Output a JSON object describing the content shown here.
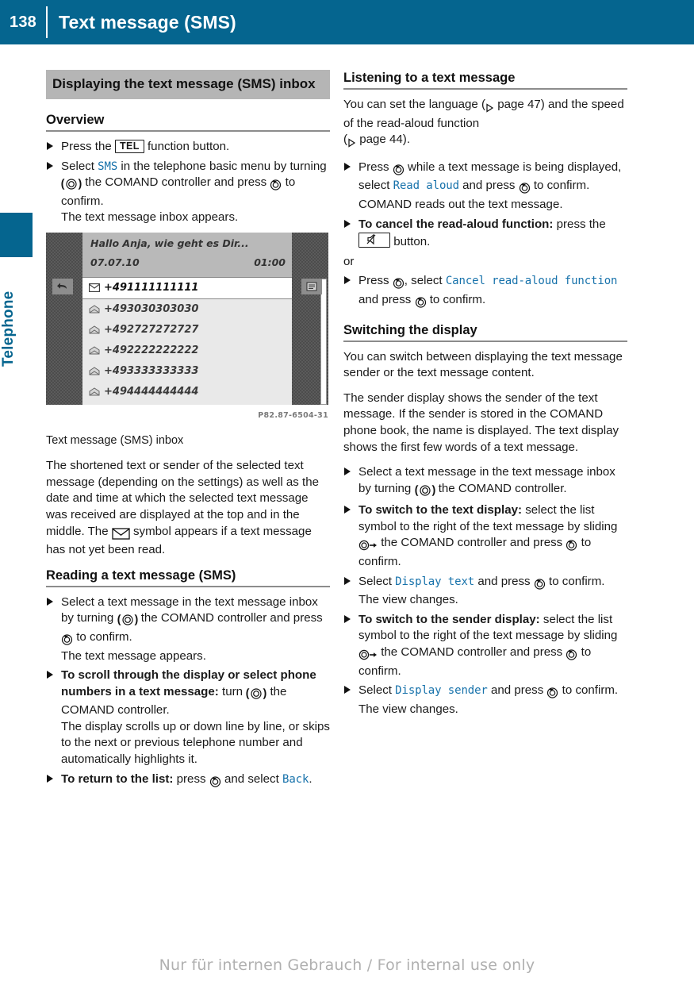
{
  "header": {
    "page_number": "138",
    "title": "Text message (SMS)"
  },
  "sidebar": {
    "tab_label": "Telephone"
  },
  "left_column": {
    "box_heading": "Displaying the text message (SMS) inbox",
    "overview": {
      "heading": "Overview",
      "step1_a": "Press the",
      "step1_button": "TEL",
      "step1_b": "function button.",
      "step2_a": "Select",
      "step2_ui": "SMS",
      "step2_b": "in the telephone basic menu by turning",
      "step2_c": "the COMAND controller and press",
      "step2_d": "to confirm.",
      "step2_result": "The text message inbox appears."
    },
    "figure": {
      "preview_text": "Hallo Anja, wie geht es Dir...",
      "date": "07.07.10",
      "time": "01:00",
      "rows": [
        "+491111111111",
        "+493030303030",
        "+492727272727",
        "+492222222222",
        "+493333333333",
        "+494444444444"
      ],
      "fig_code": "P82.87-6504-31",
      "caption": "Text message (SMS) inbox"
    },
    "body_para_a": "The shortened text or sender of the selected text message (depending on the settings) as well as the date and time at which the selected text message was received are displayed at the top and in the middle. The",
    "body_para_b": "symbol appears if a text message has not yet been read.",
    "reading": {
      "heading": "Reading a text message (SMS)",
      "step1_a": "Select a text message in the text message inbox by turning",
      "step1_b": "the COMAND controller and press",
      "step1_c": "to confirm.",
      "step1_result": "The text message appears.",
      "step2_bold": "To scroll through the display or select phone numbers in a text message:",
      "step2_a": "turn",
      "step2_b": "the COMAND controller.",
      "step2_result": "The display scrolls up or down line by line, or skips to the next or previous telephone number and automatically highlights it.",
      "step3_bold": "To return to the list:",
      "step3_a": "press",
      "step3_b": "and select",
      "step3_ui": "Back",
      "step3_c": "."
    }
  },
  "right_column": {
    "listening": {
      "heading": "Listening to a text message",
      "para_a": "You can set the language (",
      "para_b": "page 47) and the speed of the read-aloud function",
      "para_c": "(",
      "para_d": "page 44).",
      "step1_a": "Press",
      "step1_b": "while a text message is being displayed, select",
      "step1_ui": "Read aloud",
      "step1_c": "and press",
      "step1_d": "to confirm.",
      "step1_result": "COMAND reads out the text message.",
      "step2_bold": "To cancel the read-aloud function:",
      "step2_a": "press the",
      "step2_b": "button.",
      "or": "or",
      "step3_a": "Press",
      "step3_b": ", select",
      "step3_ui": "Cancel read-aloud function",
      "step3_c": "and press",
      "step3_d": "to confirm."
    },
    "switching": {
      "heading": "Switching the display",
      "para1": "You can switch between displaying the text message sender or the text message content.",
      "para2": "The sender display shows the sender of the text message. If the sender is stored in the COMAND phone book, the name is displayed. The text display shows the first few words of a text message.",
      "step1_a": "Select a text message in the text message inbox by turning",
      "step1_b": "the COMAND controller.",
      "step2_bold": "To switch to the text display:",
      "step2_a": "select the list symbol to the right of the text message by sliding",
      "step2_b": "the COMAND controller and press",
      "step2_c": "to confirm.",
      "step3_a": "Select",
      "step3_ui": "Display text",
      "step3_b": "and press",
      "step3_c": "to confirm.",
      "step3_result": "The view changes.",
      "step4_bold": "To switch to the sender display:",
      "step4_a": "select the list symbol to the right of the text message by sliding",
      "step4_b": "the COMAND controller and press",
      "step4_c": "to confirm.",
      "step5_a": "Select",
      "step5_ui": "Display sender",
      "step5_b": "and press",
      "step5_c": "to confirm.",
      "step5_result": "The view changes."
    }
  },
  "footer": {
    "watermark": "Nur für internen Gebrauch / For internal use only"
  },
  "colors": {
    "accent_blue": "#05658f",
    "ui_label_blue": "#1772ab",
    "heading_box_gray": "#b5b5b5"
  }
}
